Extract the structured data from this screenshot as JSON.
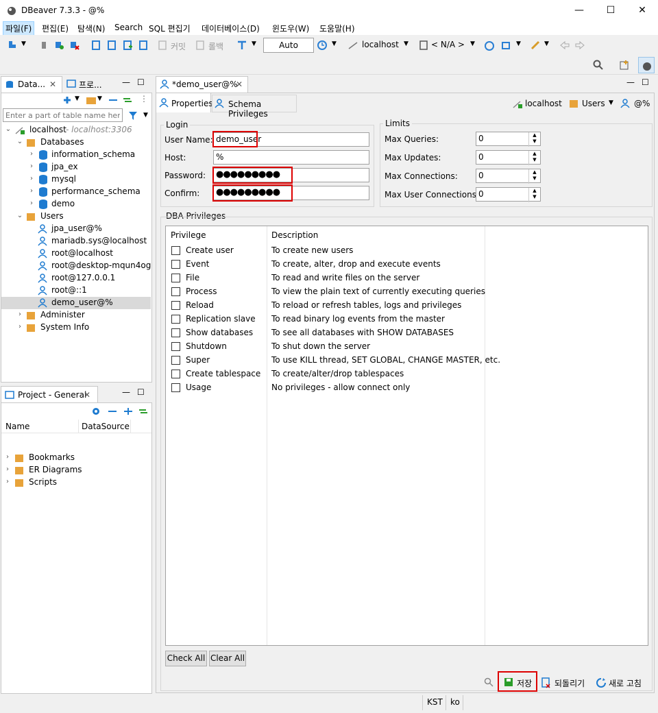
{
  "window": {
    "title": "DBeaver 7.3.3 - @%",
    "min": "—",
    "max": "☐",
    "close": "✕"
  },
  "menu": [
    "파일(F)",
    "편집(E)",
    "탐색(N)",
    "Search",
    "SQL 편집기",
    "데이터베이스(D)",
    "윈도우(W)",
    "도움말(H)"
  ],
  "toolbar": {
    "commit": "커밋",
    "rollback": "롤백",
    "mode": "Auto",
    "connection": "localhost",
    "schema": "< N/A >"
  },
  "navigator": {
    "tab1": "Data...",
    "tab2": "프로...",
    "filter_placeholder": "Enter a part of table name here",
    "root": {
      "label": "localhost",
      "hint": " - localhost:3306"
    },
    "databases_label": "Databases",
    "databases": [
      "information_schema",
      "jpa_ex",
      "mysql",
      "performance_schema",
      "demo"
    ],
    "users_label": "Users",
    "users": [
      "jpa_user@%",
      "mariadb.sys@localhost",
      "root@localhost",
      "root@desktop-mqun4og",
      "root@127.0.0.1",
      "root@::1",
      "demo_user@%"
    ],
    "administer": "Administer",
    "system_info": "System Info"
  },
  "project": {
    "tab": "Project - General",
    "col_name": "Name",
    "col_ds": "DataSource",
    "items": [
      "Bookmarks",
      "ER Diagrams",
      "Scripts"
    ]
  },
  "editor": {
    "tab": "*demo_user@%",
    "subtabs": [
      "Properties",
      "Schema Privileges"
    ],
    "crumbs": [
      "localhost",
      "Users",
      "@%"
    ],
    "login": {
      "title": "Login",
      "username_label": "User Name:",
      "username": "demo_user",
      "host_label": "Host:",
      "host": "%",
      "password_label": "Password:",
      "password": "●●●●●●●●●",
      "confirm_label": "Confirm:",
      "confirm": "●●●●●●●●●"
    },
    "limits": {
      "title": "Limits",
      "rows": [
        {
          "label": "Max Queries:",
          "value": "0"
        },
        {
          "label": "Max Updates:",
          "value": "0"
        },
        {
          "label": "Max Connections:",
          "value": "0"
        },
        {
          "label": "Max User Connections:",
          "value": "0"
        }
      ]
    },
    "dba": {
      "title": "DBA Privileges",
      "col_priv": "Privilege",
      "col_desc": "Description",
      "rows": [
        {
          "p": "Create user",
          "d": "To create new users"
        },
        {
          "p": "Event",
          "d": "To create, alter, drop and execute events"
        },
        {
          "p": "File",
          "d": "To read and write files on the server"
        },
        {
          "p": "Process",
          "d": "To view the plain text of currently executing queries"
        },
        {
          "p": "Reload",
          "d": "To reload or refresh tables, logs and privileges"
        },
        {
          "p": "Replication slave",
          "d": "To read binary log events from the master"
        },
        {
          "p": "Show databases",
          "d": "To see all databases with SHOW DATABASES"
        },
        {
          "p": "Shutdown",
          "d": "To shut down the server"
        },
        {
          "p": "Super",
          "d": "To use KILL thread, SET GLOBAL, CHANGE MASTER, etc."
        },
        {
          "p": "Create tablespace",
          "d": "To create/alter/drop tablespaces"
        },
        {
          "p": "Usage",
          "d": "No privileges - allow connect only"
        }
      ]
    },
    "check_all": "Check All",
    "clear_all": "Clear All",
    "save": "저장",
    "revert": "되돌리기",
    "refresh": "새로 고침"
  },
  "status": {
    "tz": "KST",
    "locale": "ko"
  }
}
